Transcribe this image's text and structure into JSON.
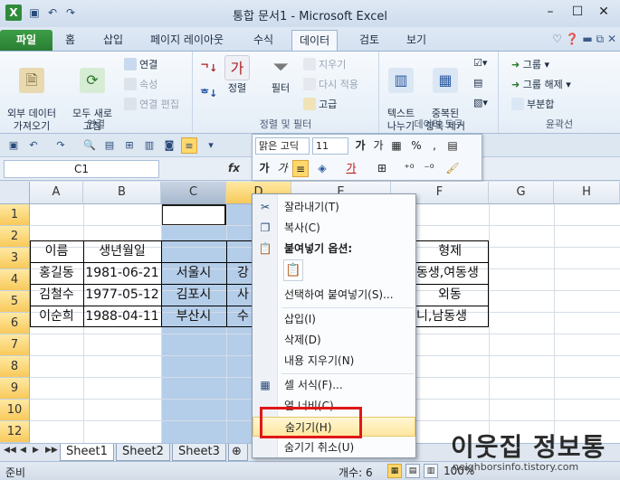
{
  "window": {
    "title": "통합 문서1 - Microsoft Excel",
    "controls": {
      "minimize": "–",
      "maximize": "☐",
      "close": "✕"
    }
  },
  "ribbon_tabs": [
    "홈",
    "삽입",
    "페이지 레이아웃",
    "수식",
    "데이터",
    "검토",
    "보기"
  ],
  "file_tab": "파일",
  "active_tab": "데이터",
  "ribbon": {
    "groups": {
      "connections": "연결",
      "sort_filter": "정렬 및 필터",
      "data_tools": "데이터 도구",
      "outline": "윤곽선"
    },
    "buttons": {
      "external_data": "외부 데이터\n가져오기",
      "refresh_all": "모두 새로\n고침",
      "connections": "연결",
      "properties": "속성",
      "edit_links": "연결 편집",
      "sort": "정렬",
      "filter": "필터",
      "clear": "지우기",
      "reapply": "다시 적용",
      "advanced": "고급",
      "text_to_columns": "텍스트\n나누기",
      "remove_duplicates": "중복된\n항목 제거",
      "group": "그룹",
      "ungroup": "그룹 해제",
      "subtotal": "부분합"
    }
  },
  "mini_toolbar": {
    "font": "맑은 고딕",
    "size": "11"
  },
  "name_box": "C1",
  "fx_label": "fx",
  "columns": [
    "A",
    "B",
    "C",
    "D",
    "E",
    "F",
    "G",
    "H"
  ],
  "rows": [
    "1",
    "2",
    "3",
    "4",
    "5",
    "6",
    "7",
    "8",
    "9",
    "10",
    "11",
    "12"
  ],
  "table": {
    "headers": {
      "a": "이름",
      "b": "생년월일",
      "f": "형제"
    },
    "rows": [
      {
        "a": "홍길동",
        "b": "1981-06-21",
        "c": "서울시",
        "d": "강",
        "f": "동생,여동생"
      },
      {
        "a": "김철수",
        "b": "1977-05-12",
        "c": "김포시",
        "d": "사",
        "f": "외동"
      },
      {
        "a": "이순희",
        "b": "1988-04-11",
        "c": "부산시",
        "d": "수",
        "f": "니,남동생"
      }
    ]
  },
  "context_menu": {
    "items": [
      {
        "label": "잘라내기(T)",
        "icon": "scissors-icon"
      },
      {
        "label": "복사(C)",
        "icon": "copy-icon"
      },
      {
        "label": "붙여넣기 옵션:",
        "icon": "paste-icon"
      },
      {
        "label": "선택하여 붙여넣기(S)...",
        "icon": ""
      },
      {
        "label": "삽입(I)",
        "icon": ""
      },
      {
        "label": "삭제(D)",
        "icon": ""
      },
      {
        "label": "내용 지우기(N)",
        "icon": ""
      },
      {
        "label": "셀 서식(F)...",
        "icon": "format-cells-icon"
      },
      {
        "label": "열 너비(C)...",
        "icon": ""
      },
      {
        "label": "숨기기(H)",
        "icon": ""
      },
      {
        "label": "숨기기 취소(U)",
        "icon": ""
      }
    ],
    "highlighted": "숨기기(H)"
  },
  "sheets": [
    "Sheet1",
    "Sheet2",
    "Sheet3"
  ],
  "active_sheet": "Sheet1",
  "status": {
    "mode": "준비",
    "count": "개수: 6",
    "zoom": "100%"
  },
  "watermark": {
    "title": "이웃집 정보통",
    "url": "neighborsinfo.tistory.com"
  },
  "colors": {
    "accent_green": "#2e8b3a",
    "selection_blue": "#b4cde9",
    "highlight_yellow": "#ffe7a0",
    "annotation_red": "#e01818"
  }
}
